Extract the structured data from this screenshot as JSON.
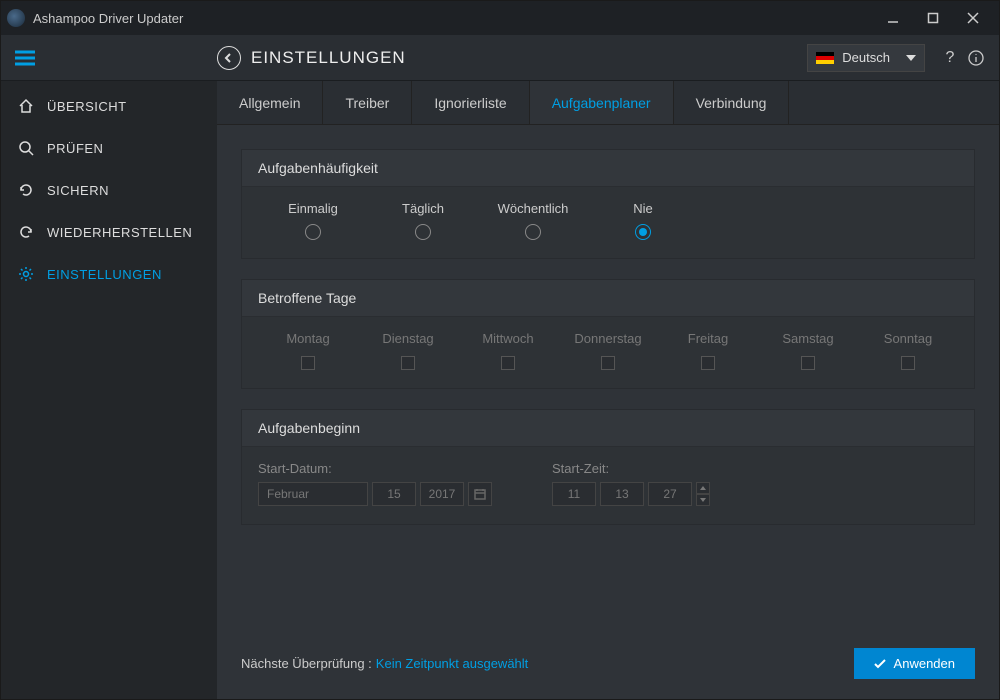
{
  "window": {
    "title": "Ashampoo Driver Updater"
  },
  "header": {
    "title": "EINSTELLUNGEN",
    "language": "Deutsch"
  },
  "sidebar": {
    "items": [
      {
        "label": "ÜBERSICHT",
        "icon": "home"
      },
      {
        "label": "PRÜFEN",
        "icon": "search"
      },
      {
        "label": "SICHERN",
        "icon": "refresh"
      },
      {
        "label": "WIEDERHERSTELLEN",
        "icon": "restore"
      },
      {
        "label": "EINSTELLUNGEN",
        "icon": "gear",
        "active": true
      }
    ]
  },
  "tabs": [
    {
      "label": "Allgemein"
    },
    {
      "label": "Treiber"
    },
    {
      "label": "Ignorierliste"
    },
    {
      "label": "Aufgabenplaner",
      "active": true
    },
    {
      "label": "Verbindung"
    }
  ],
  "frequency": {
    "title": "Aufgabenhäufigkeit",
    "options": [
      {
        "label": "Einmalig"
      },
      {
        "label": "Täglich"
      },
      {
        "label": "Wöchentlich"
      },
      {
        "label": "Nie",
        "selected": true
      }
    ]
  },
  "days": {
    "title": "Betroffene Tage",
    "options": [
      {
        "label": "Montag"
      },
      {
        "label": "Dienstag"
      },
      {
        "label": "Mittwoch"
      },
      {
        "label": "Donnerstag"
      },
      {
        "label": "Freitag"
      },
      {
        "label": "Samstag"
      },
      {
        "label": "Sonntag"
      }
    ]
  },
  "start": {
    "title": "Aufgabenbeginn",
    "date_label": "Start-Datum:",
    "time_label": "Start-Zeit:",
    "month": "Februar",
    "day": "15",
    "year": "2017",
    "hour": "11",
    "minute": "13",
    "second": "27"
  },
  "footer": {
    "label": "Nächste Überprüfung :",
    "value": "Kein Zeitpunkt ausgewählt",
    "apply": "Anwenden"
  }
}
